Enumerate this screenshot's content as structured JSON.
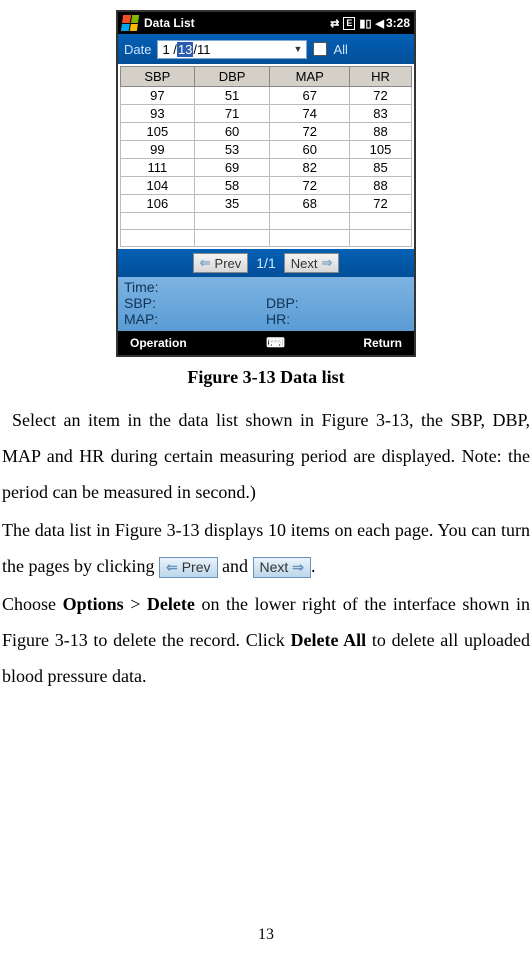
{
  "device": {
    "statusbar": {
      "title": "Data List",
      "time": "3:28",
      "icons": [
        "sync",
        "E",
        "signal",
        "volume"
      ]
    },
    "datebar": {
      "label": "Date",
      "value_pre": "1 /",
      "value_sel": "13",
      "value_post": "/11",
      "all_label": "All"
    },
    "table": {
      "headers": [
        "SBP",
        "DBP",
        "MAP",
        "HR"
      ],
      "rows": [
        [
          "97",
          "51",
          "67",
          "72"
        ],
        [
          "93",
          "71",
          "74",
          "83"
        ],
        [
          "105",
          "60",
          "72",
          "88"
        ],
        [
          "99",
          "53",
          "60",
          "105"
        ],
        [
          "111",
          "69",
          "82",
          "85"
        ],
        [
          "104",
          "58",
          "72",
          "88"
        ],
        [
          "106",
          "35",
          "68",
          "72"
        ]
      ]
    },
    "pager": {
      "prev": "Prev",
      "next": "Next",
      "info": "1/1"
    },
    "detail": {
      "time": "Time:",
      "sbp": "SBP:",
      "dbp": "DBP:",
      "map": "MAP:",
      "hr": "HR:"
    },
    "bottombar": {
      "left": "Operation",
      "right": "Return"
    }
  },
  "caption": "Figure 3-13 Data list",
  "text": {
    "p1": "Select an item in the data list shown in Figure 3-13, the SBP, DBP, MAP and HR during certain measuring period are displayed. Note: the period can be measured in second.)",
    "p2a": "The data list in Figure 3-13 displays 10 items on each page. You can turn the pages by clicking ",
    "p2b": " and ",
    "p2c": ".",
    "p3a": "Choose ",
    "p3b": "Options",
    "p3c": " > ",
    "p3d": "Delete",
    "p3e": " on the lower right of the interface shown in Figure 3-13 to delete the record. Click ",
    "p3f": "Delete All",
    "p3g": " to delete all uploaded blood pressure data.",
    "prev_btn": "Prev",
    "next_btn": "Next"
  },
  "page_number": "13"
}
